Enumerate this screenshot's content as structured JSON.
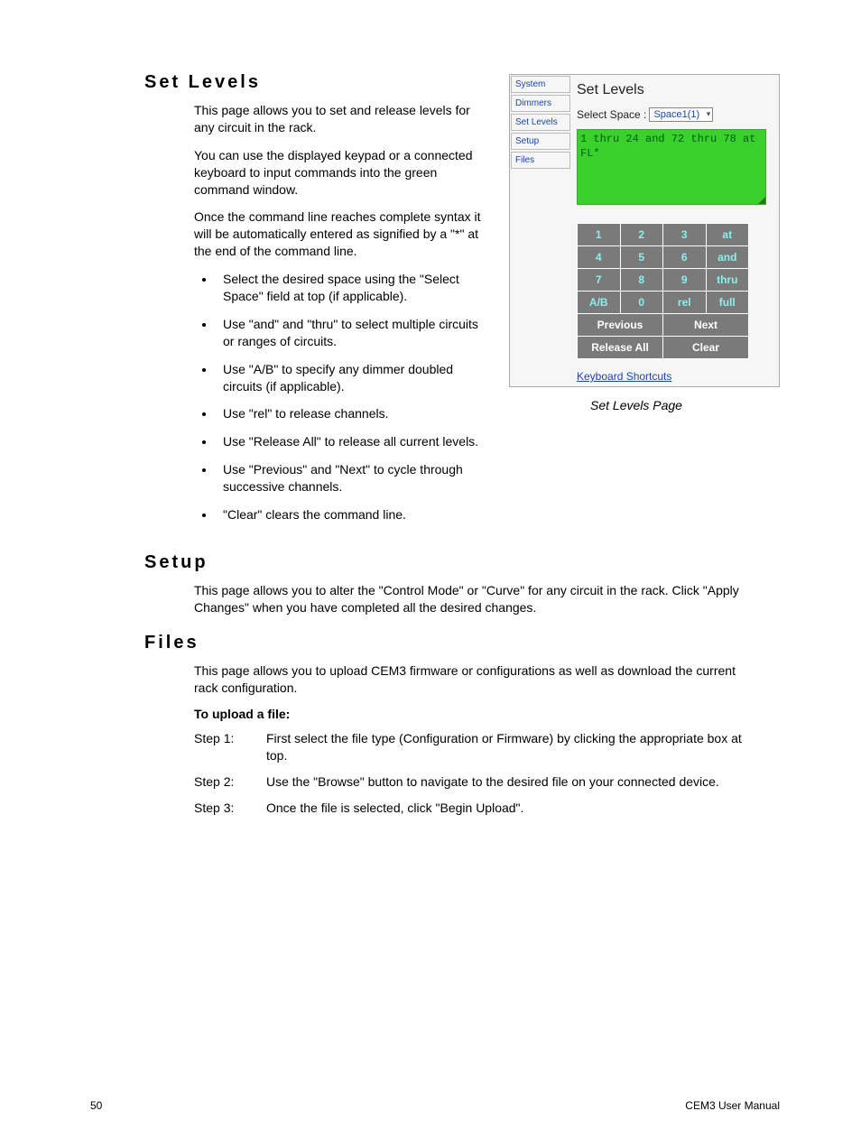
{
  "sections": {
    "set_levels": {
      "heading": "Set Levels",
      "p1": "This page allows you to set and release levels for any circuit in the rack.",
      "p2": "You can use the displayed keypad or a connected keyboard to input commands into the green command window.",
      "p3": "Once the command line reaches complete syntax it will be automatically entered as signified by a \"*\" at the end of the command line.",
      "bullets": [
        "Select the desired space using the \"Select Space\" field at top (if applicable).",
        "Use \"and\" and \"thru\" to select multiple circuits or ranges of circuits.",
        "Use \"A/B\" to specify any dimmer doubled circuits (if applicable).",
        "Use \"rel\" to release channels.",
        "Use \"Release All\" to release all current levels.",
        "Use \"Previous\" and \"Next\" to cycle through successive channels.",
        "\"Clear\" clears the command line."
      ]
    },
    "setup": {
      "heading": "Setup",
      "p1": "This page allows you to alter the \"Control Mode\" or \"Curve\" for any circuit in the rack. Click \"Apply Changes\" when you have completed all the desired changes."
    },
    "files": {
      "heading": "Files",
      "p1": "This page allows you to upload CEM3 firmware or configurations as well as download the current rack configuration.",
      "upload_heading": "To upload a file:",
      "steps": [
        {
          "label": "Step 1:",
          "text": "First select the file type (Configuration or Firmware) by clicking the appropriate box at top."
        },
        {
          "label": "Step 2:",
          "text": "Use the \"Browse\" button to navigate to the desired file on your connected device."
        },
        {
          "label": "Step 3:",
          "text": "Once the file is selected, click \"Begin Upload\"."
        }
      ]
    }
  },
  "screenshot": {
    "sidebar": [
      "System",
      "Dimmers",
      "Set Levels",
      "Setup",
      "Files"
    ],
    "title": "Set Levels",
    "select_label": "Select Space :",
    "select_value": "Space1(1)",
    "cmd_text": "1 thru 24 and 72 thru 78 at FL*",
    "keypad": {
      "rows": [
        [
          "1",
          "2",
          "3",
          "at"
        ],
        [
          "4",
          "5",
          "6",
          "and"
        ],
        [
          "7",
          "8",
          "9",
          "thru"
        ],
        [
          "A/B",
          "0",
          "rel",
          "full"
        ]
      ],
      "bottom": [
        [
          "Previous",
          "Next"
        ],
        [
          "Release All",
          "Clear"
        ]
      ]
    },
    "kb_link": "Keyboard Shortcuts",
    "caption": "Set Levels Page"
  },
  "footer": {
    "page": "50",
    "manual": "CEM3 User Manual"
  }
}
